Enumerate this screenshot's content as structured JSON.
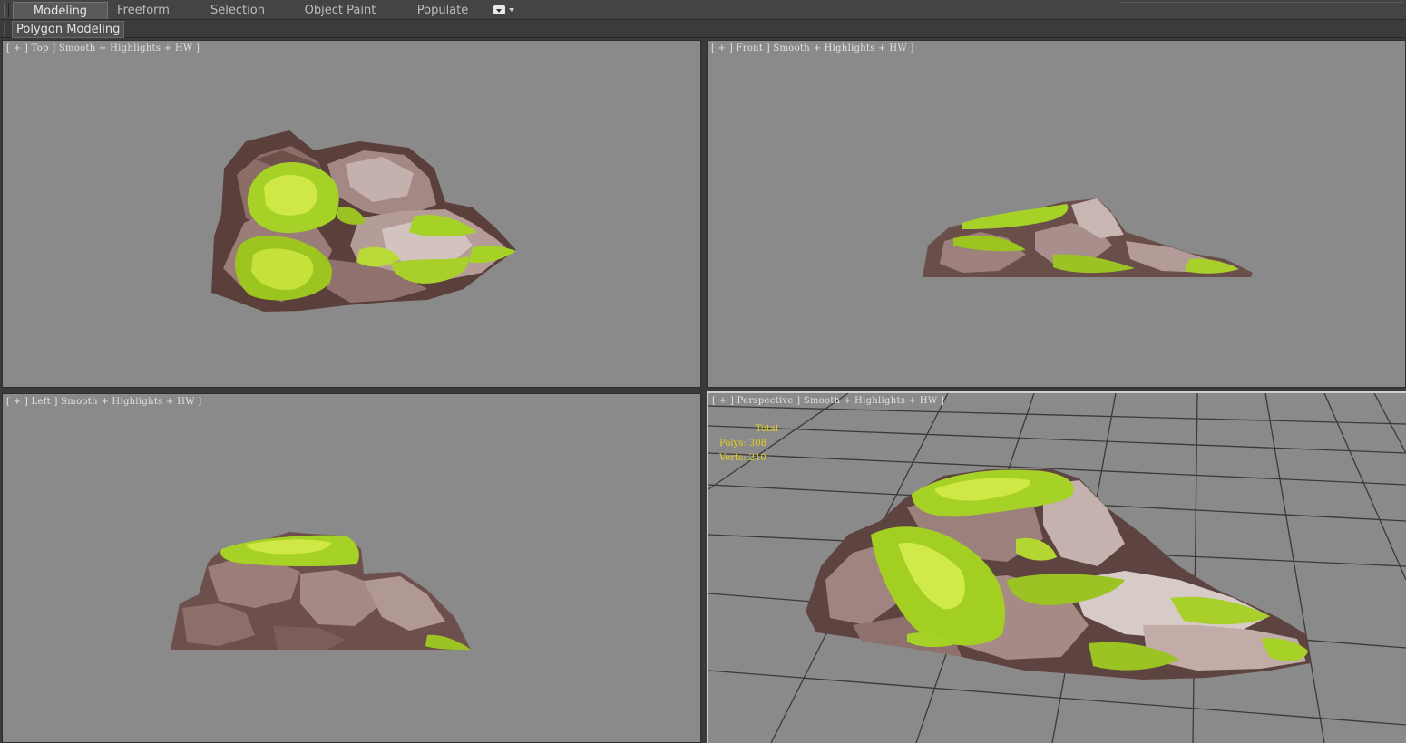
{
  "ribbon": {
    "tabs": [
      {
        "label": "Modeling",
        "active": true
      },
      {
        "label": "Freeform",
        "active": false
      },
      {
        "label": "Selection",
        "active": false
      },
      {
        "label": "Object Paint",
        "active": false
      },
      {
        "label": "Populate",
        "active": false
      }
    ],
    "dropdown_icon": "dropdown-toggle-icon"
  },
  "panel": {
    "label": "Polygon Modeling"
  },
  "viewports": {
    "top": {
      "label": "[ + ] Top ] Smooth + Highlights + HW ]"
    },
    "front": {
      "label": "[ + ] Front ] Smooth + Highlights + HW ]"
    },
    "left": {
      "label": "[ + ] Left ] Smooth + Highlights + HW ]"
    },
    "perspective": {
      "label": "[ + ] Perspective ] Smooth + Highlights + HW ]",
      "stats": {
        "title": "Total",
        "polys": "Polys: 308",
        "verts": "Verts: 210"
      }
    }
  },
  "colors": {
    "viewport_bg": "#8a8a8a",
    "rock": "#8b6a66",
    "rock_light": "#c9b5b0",
    "rock_dark": "#4d3532",
    "moss": "#a6d126",
    "moss_light": "#cfe845",
    "stats_text": "#e6d21a"
  }
}
